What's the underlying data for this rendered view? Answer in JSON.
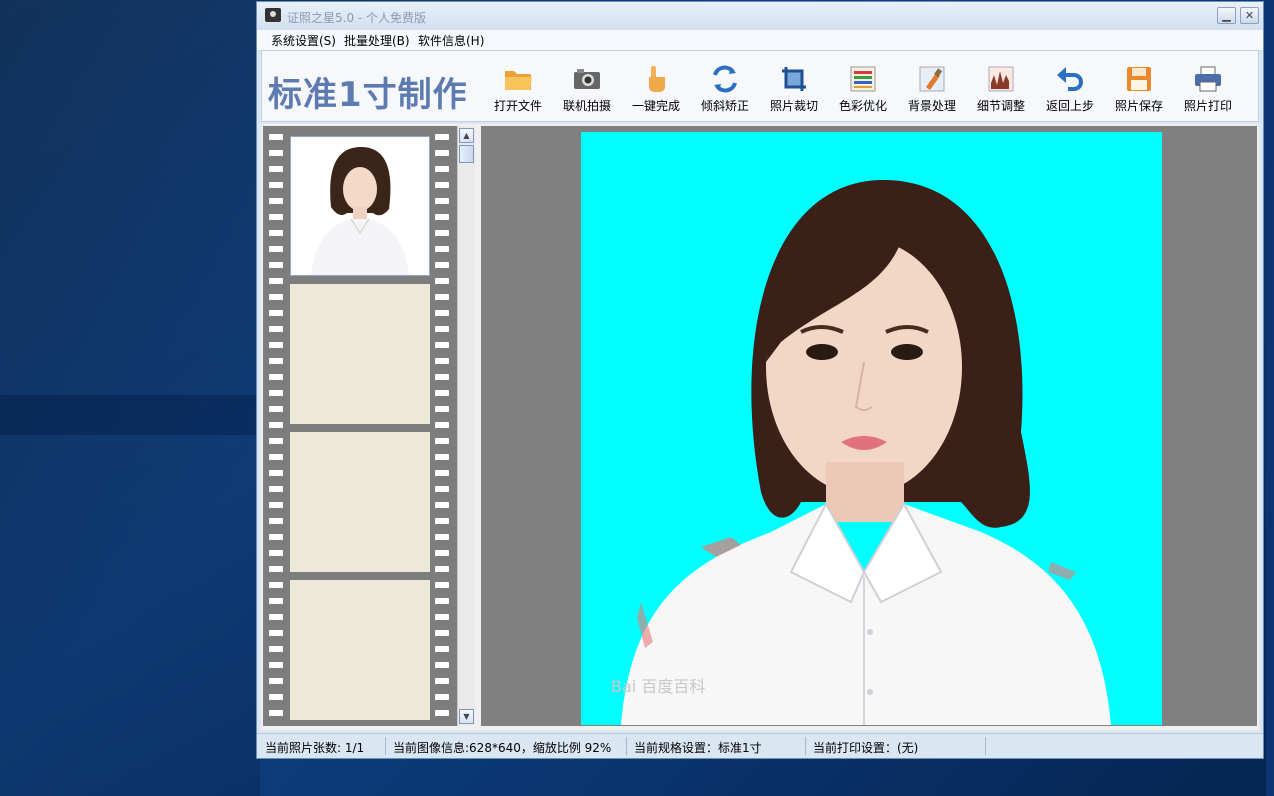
{
  "window": {
    "title": "证照之星5.0 - 个人免费版",
    "minimize_label": "▁",
    "close_label": "✕"
  },
  "menu": [
    {
      "label": "系统设置(S)"
    },
    {
      "label": "批量处理(B)"
    },
    {
      "label": "软件信息(H)"
    }
  ],
  "brand": "标准1寸制作",
  "toolbar": [
    {
      "label": "打开文件",
      "icon": "folder-icon"
    },
    {
      "label": "联机拍摄",
      "icon": "camera-icon"
    },
    {
      "label": "一键完成",
      "icon": "hand-pointer-icon"
    },
    {
      "label": "倾斜矫正",
      "icon": "rotate-icon"
    },
    {
      "label": "照片裁切",
      "icon": "crop-icon"
    },
    {
      "label": "色彩优化",
      "icon": "color-palette-icon"
    },
    {
      "label": "背景处理",
      "icon": "brush-icon"
    },
    {
      "label": "细节调整",
      "icon": "histogram-icon"
    },
    {
      "label": "返回上步",
      "icon": "undo-icon"
    },
    {
      "label": "照片保存",
      "icon": "floppy-disk-icon"
    },
    {
      "label": "照片打印",
      "icon": "printer-icon"
    }
  ],
  "preview": {
    "background_color": "#00ffff",
    "watermark": "Bai 百度百科"
  },
  "status": {
    "count": "当前照片张数: 1/1",
    "image_info": "当前图像信息:628*640，缩放比例 92%",
    "spec": "当前规格设置：标准1寸",
    "print": "当前打印设置：(无)"
  },
  "colors": {
    "brand": "#5d7bb0",
    "film": "#7d7d7d",
    "empty_frame": "#ece9d8"
  }
}
